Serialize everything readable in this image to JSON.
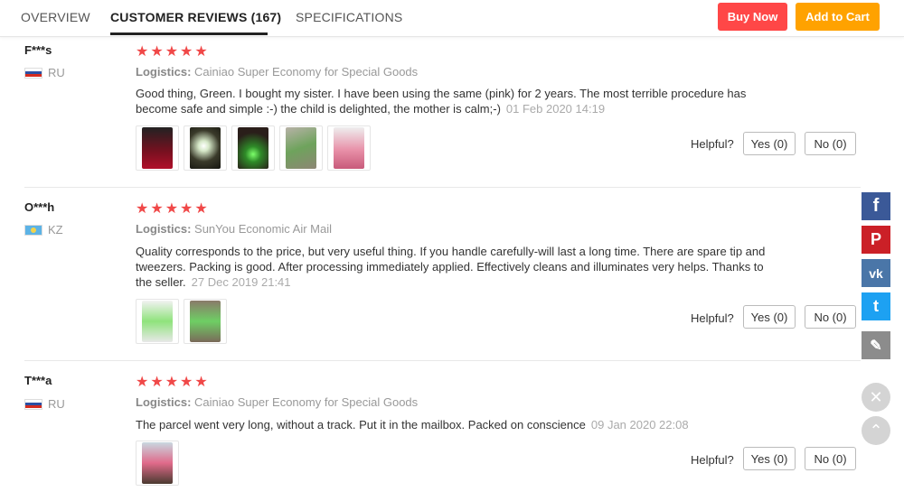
{
  "tabs": [
    {
      "label": "OVERVIEW"
    },
    {
      "label": "CUSTOMER REVIEWS (167)"
    },
    {
      "label": "SPECIFICATIONS"
    }
  ],
  "actions": {
    "buy_now": "Buy Now",
    "add_to_cart": "Add to Cart"
  },
  "colors": {
    "buy_now": "#ff4747",
    "add_to_cart": "#ffa200",
    "stars": "#f04848",
    "facebook": "#3b5998",
    "pinterest": "#cb2027",
    "vk": "#4a76a8",
    "twitter": "#1da1f2",
    "edit": "#8c8c8c"
  },
  "reviews": [
    {
      "user": "F***s",
      "country": "RU",
      "stars": "★★★★★",
      "logistics_label": "Logistics:",
      "logistics": "Cainiao Super Economy for Special Goods",
      "text": "Good thing, Green. I bought my sister. I have been using the same (pink) for 2 years. The most terrible procedure has become safe and simple :-) the child is delighted, the mother is calm;-)",
      "date": "01 Feb 2020 14:19",
      "helpful": "Helpful?",
      "yes": "Yes (0)",
      "no": "No (0)"
    },
    {
      "user": "O***h",
      "country": "KZ",
      "stars": "★★★★★",
      "logistics_label": "Logistics:",
      "logistics": "SunYou Economic Air Mail",
      "text": "Quality corresponds to the price, but very useful thing. If you handle carefully-will last a long time. There are spare tip and tweezers. Packing is good. After processing immediately applied. Effectively cleans and illuminates very helps. Thanks to the seller.",
      "date": "27 Dec 2019 21:41",
      "helpful": "Helpful?",
      "yes": "Yes (0)",
      "no": "No (0)"
    },
    {
      "user": "T***a",
      "country": "RU",
      "stars": "★★★★★",
      "logistics_label": "Logistics:",
      "logistics": "Cainiao Super Economy for Special Goods",
      "text": "The parcel went very long, without a track. Put it in the mailbox. Packed on conscience",
      "date": "09 Jan 2020 22:08",
      "helpful": "Helpful?",
      "yes": "Yes (0)",
      "no": "No (0)"
    }
  ],
  "social": {
    "facebook": "f",
    "pinterest": "P",
    "vk": "vk",
    "twitter": "t",
    "edit": "✎",
    "close": "✕",
    "up": "⌃"
  }
}
